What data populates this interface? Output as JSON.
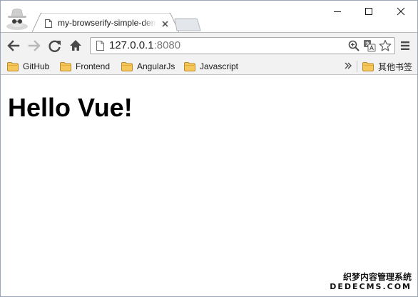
{
  "browser": {
    "tab": {
      "title": "my-browserify-simple-demo"
    },
    "window_controls": {
      "minimize": "—",
      "maximize": "☐",
      "close": "✕"
    },
    "address_bar": {
      "host": "127.0.0.1",
      "port": ":8080"
    },
    "bookmarks": [
      {
        "label": "GitHub"
      },
      {
        "label": "Frontend"
      },
      {
        "label": "AngularJs"
      },
      {
        "label": "Javascript"
      }
    ],
    "other_bookmarks": "其他书签",
    "overflow_chevron": "»"
  },
  "page": {
    "heading": "Hello Vue!"
  },
  "watermark": {
    "line1": "织梦内容管理系统",
    "line2": "DEDECMS.COM"
  },
  "colors": {
    "toolbar_bg": "#f2f2f2",
    "folder_fill": "#f5c65a",
    "folder_stroke": "#b78a2a",
    "icon_gray": "#4a4a4a"
  }
}
